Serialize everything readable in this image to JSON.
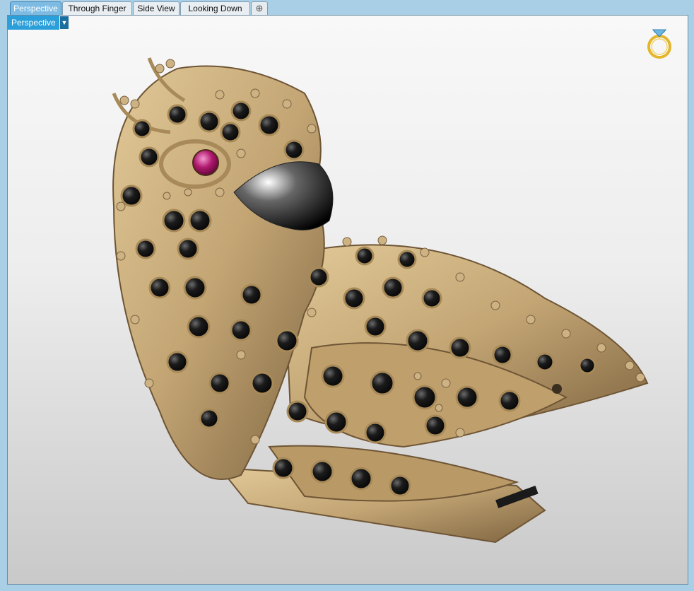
{
  "tabs": [
    {
      "label": "Perspective",
      "active": true
    },
    {
      "label": "Through Finger",
      "active": false
    },
    {
      "label": "Side View",
      "active": false
    },
    {
      "label": "Looking Down",
      "active": false
    }
  ],
  "add_tab_icon": "plus-icon",
  "viewport": {
    "view_name": "Perspective",
    "dropdown_icon": "triangle-down-icon",
    "navigator_icon": "ring-icon"
  },
  "colors": {
    "accent": "#2b9fd9",
    "metal_gold": "#c7ad7a",
    "stone_black": "#141414",
    "ruby": "#b0186e"
  }
}
